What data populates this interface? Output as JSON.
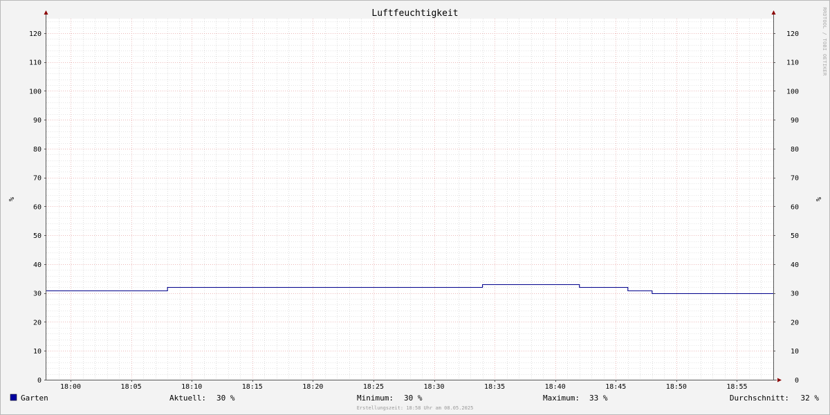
{
  "chart_data": {
    "type": "line",
    "title": "Luftfeuchtigkeit",
    "ylabel_left": "%",
    "ylabel_right": "%",
    "watermark": "RRDTOOL / TOBI OETIKER",
    "ylim": [
      0,
      125
    ],
    "yticks": [
      0,
      10,
      20,
      30,
      40,
      50,
      60,
      70,
      80,
      90,
      100,
      110,
      120
    ],
    "ytick_labels": [
      "0",
      "10",
      "20",
      "30",
      "40",
      "50",
      "60",
      "70",
      "80",
      "90",
      "100",
      "110",
      "120"
    ],
    "xlim": [
      "17:58",
      "18:58"
    ],
    "xticks": [
      "18:00",
      "18:05",
      "18:10",
      "18:15",
      "18:20",
      "18:25",
      "18:30",
      "18:35",
      "18:40",
      "18:45",
      "18:50",
      "18:55"
    ],
    "grid": true,
    "colors": {
      "series": "#00008b",
      "legend_swatch": "#0000a0",
      "major_grid": "#e6a0a0",
      "minor_grid": "#c8c8c8",
      "axis": "#555555",
      "arrow": "#8b0000",
      "plot_bg": "#ffffff",
      "page_bg": "#f3f3f3"
    },
    "series": [
      {
        "name": "Garten",
        "step": true,
        "points": [
          [
            "17:58",
            31
          ],
          [
            "18:08",
            32
          ],
          [
            "18:34",
            33
          ],
          [
            "18:42",
            32
          ],
          [
            "18:46",
            31
          ],
          [
            "18:48",
            30
          ],
          [
            "18:58",
            30
          ]
        ]
      }
    ],
    "legend": {
      "name": "Garten",
      "stats": [
        {
          "label": "Aktuell:",
          "value": "30 %"
        },
        {
          "label": "Minimum:",
          "value": "30 %"
        },
        {
          "label": "Maximum:",
          "value": "33 %"
        },
        {
          "label": "Durchschnitt:",
          "value": "32 %"
        }
      ]
    },
    "footer": "Erstellungszeit: 18:58 Uhr am 08.05.2025"
  }
}
